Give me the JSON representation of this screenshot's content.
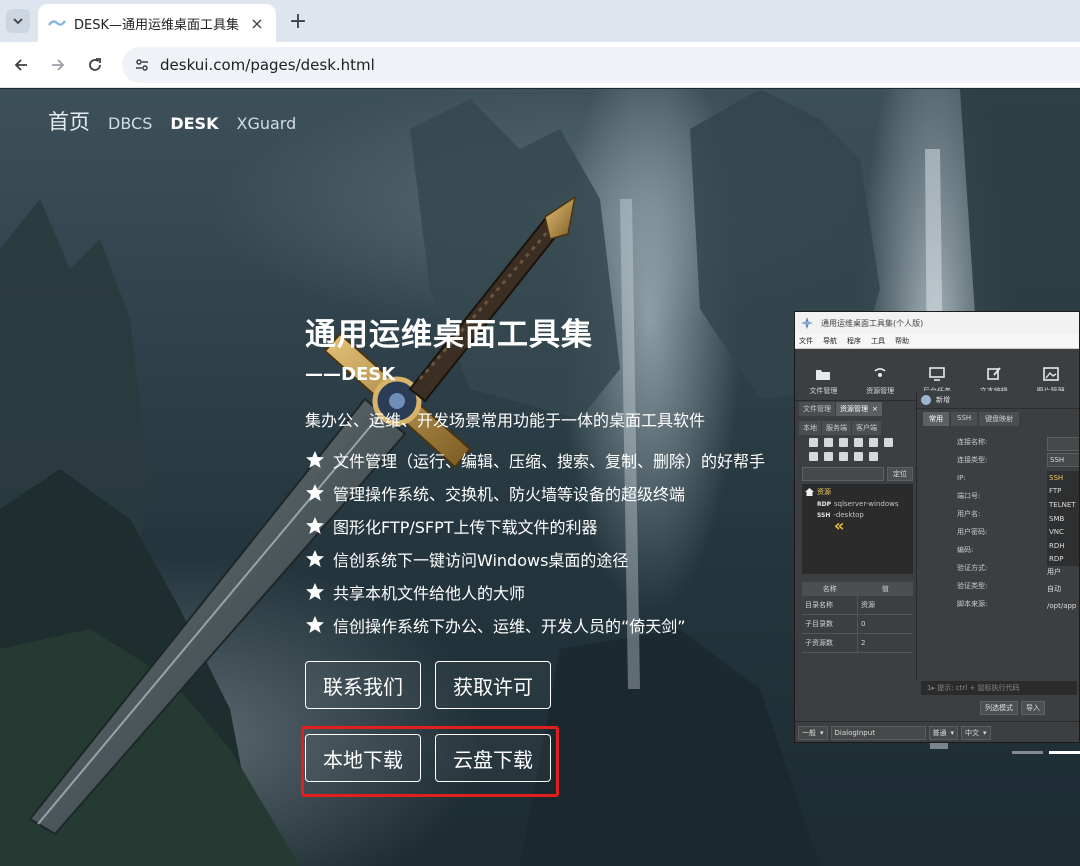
{
  "browser": {
    "tab_title": "DESK—通用运维桌面工具集",
    "tab_close": "×",
    "new_tab": "+",
    "url": "deskui.com/pages/desk.html"
  },
  "nav": {
    "home": "首页",
    "items": [
      "DBCS",
      "DESK",
      "XGuard"
    ],
    "active": "DESK"
  },
  "hero": {
    "title": "通用运维桌面工具集",
    "subtitle": "——DESK",
    "description": "集办公、运维、开发场景常用功能于一体的桌面工具软件",
    "features": [
      "文件管理（运行、编辑、压缩、搜索、复制、删除）的好帮手",
      "管理操作系统、交换机、防火墙等设备的超级终端",
      "图形化FTP/SFPT上传下载文件的利器",
      "信创系统下一键访问Windows桌面的途径",
      "共享本机文件给他人的大师",
      "信创操作系统下办公、运维、开发人员的“倚天剑”"
    ]
  },
  "buttons": {
    "contact": "联系我们",
    "license": "获取许可",
    "local_download": "本地下载",
    "cloud_download": "云盘下载"
  },
  "app": {
    "title": "通用运维桌面工具集(个人版)",
    "menu": [
      "文件",
      "导航",
      "程序",
      "工具",
      "帮助"
    ],
    "ribbon": [
      "文件管理",
      "资源管理",
      "后台任务",
      "文本编辑",
      "图片管理"
    ],
    "left_tabs": [
      "文件管理",
      "资源管理"
    ],
    "left_tab_close": "×",
    "sub_tabs": [
      "本地",
      "服务端",
      "客户端"
    ],
    "locate": "定位",
    "tree_root": "资源",
    "tree_items": [
      {
        "tag": "RDP",
        "label": "sqlserver-windows"
      },
      {
        "tag": "SSH",
        "label": "-desktop"
      }
    ],
    "collapse": "«",
    "props_head": [
      "名称",
      "值"
    ],
    "props_rows": [
      [
        "目录名称",
        "资源"
      ],
      [
        "子目录数",
        "0"
      ],
      [
        "子资源数",
        "2"
      ]
    ],
    "right_header": "新增",
    "right_tabs": [
      "常用",
      "SSH",
      "键盘映射"
    ],
    "form_labels": [
      "连接名称:",
      "连接类型:",
      "IP:",
      "端口号:",
      "用户名:",
      "用户密码:",
      "编码:",
      "验证方式:",
      "验证类型:",
      "脚本来源:"
    ],
    "form_values": {
      "type": "SSH",
      "auth": "用户",
      "verify": "自动",
      "script": "/opt/app"
    },
    "type_options": [
      "SSH",
      "FTP",
      "TELNET",
      "SMB",
      "VNC",
      "RDH",
      "RDP"
    ],
    "editor_hint": "1▸ 提示: ctrl + 鼠标执行代码",
    "mini_buttons": [
      "列选模式",
      "导入"
    ],
    "bottom": [
      "一般",
      "DialogInput",
      "普通",
      "中文"
    ]
  },
  "colors": {
    "highlight": "#e0201e",
    "text": "#ffffff"
  }
}
